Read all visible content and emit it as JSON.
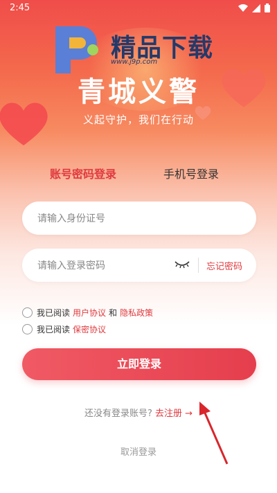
{
  "status_bar": {
    "time": "2:45"
  },
  "branding": {
    "watermark_title": "精品下载",
    "watermark_url": "www.j9p.com",
    "app_title": "青城义警",
    "slogan": "义起守护，我们在行动"
  },
  "tabs": [
    {
      "label": "账号密码登录",
      "active": true
    },
    {
      "label": "手机号登录",
      "active": false
    }
  ],
  "form": {
    "id_placeholder": "请输入身份证号",
    "password_placeholder": "请输入登录密码",
    "forgot_label": "忘记密码"
  },
  "agreements": [
    {
      "prefix": "我已阅读",
      "link1": "用户协议",
      "joiner": "和",
      "link2": "隐私政策"
    },
    {
      "prefix": "我已阅读",
      "link1": "保密协议"
    }
  ],
  "login_button": "立即登录",
  "register": {
    "prompt": "还没有登录账号?",
    "link": "去注册 →"
  },
  "cancel_label": "取消登录",
  "colors": {
    "accent": "#e03a3f",
    "hero_top": "#f04d4a",
    "brand_text": "#233a6a",
    "annotation_arrow": "#d8262c"
  }
}
